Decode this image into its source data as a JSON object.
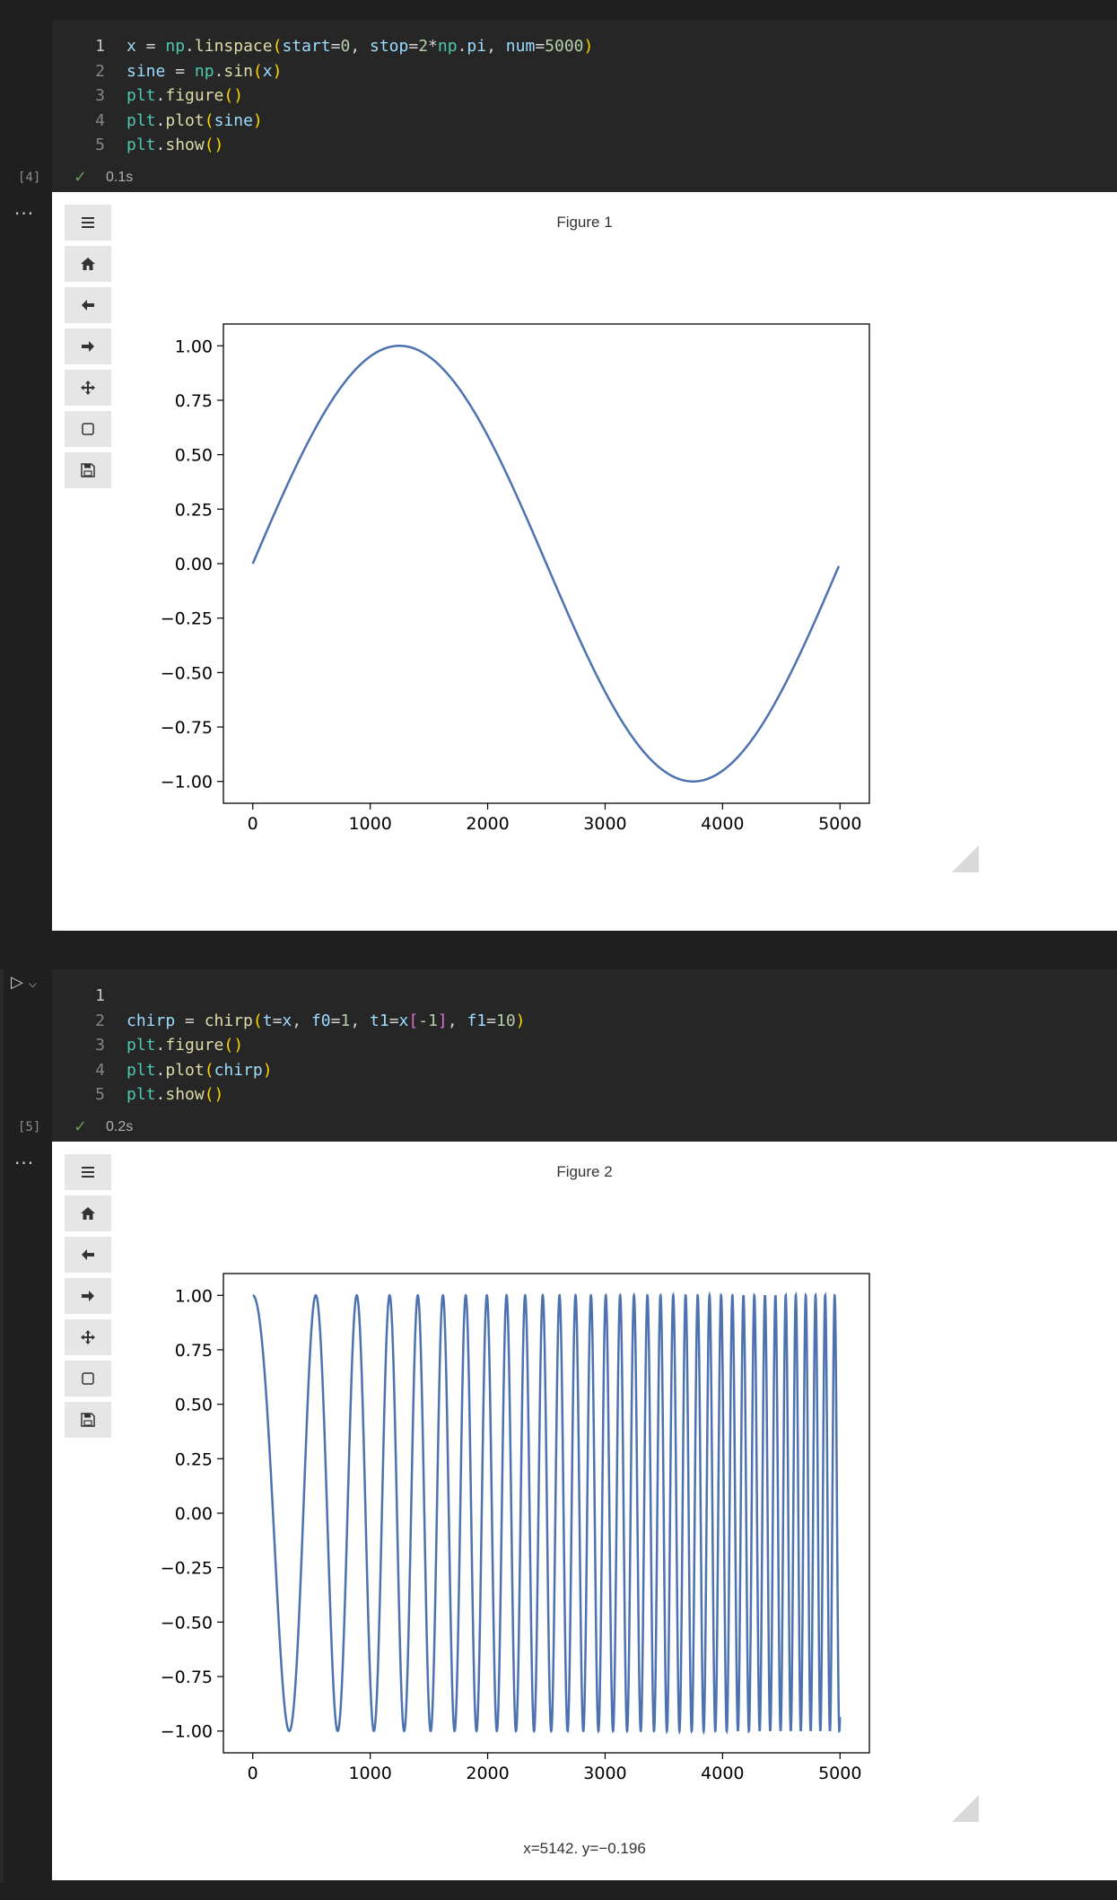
{
  "cells": [
    {
      "exec_label": "[4]",
      "status_time": "0.1s",
      "lines": [
        {
          "num": "1",
          "tokens": [
            [
              "x",
              "t-var"
            ],
            [
              " = ",
              "t-op"
            ],
            [
              "np",
              "t-mod"
            ],
            [
              ".",
              "t-op"
            ],
            [
              "linspace",
              "t-fn"
            ],
            [
              "(",
              "t-par"
            ],
            [
              "start",
              "t-var"
            ],
            [
              "=",
              "t-op"
            ],
            [
              "0",
              "t-num"
            ],
            [
              ", ",
              "t-op"
            ],
            [
              "stop",
              "t-var"
            ],
            [
              "=",
              "t-op"
            ],
            [
              "2",
              "t-num"
            ],
            [
              "*",
              "t-op"
            ],
            [
              "np",
              "t-mod"
            ],
            [
              ".",
              "t-op"
            ],
            [
              "pi",
              "t-var"
            ],
            [
              ", ",
              "t-op"
            ],
            [
              "num",
              "t-var"
            ],
            [
              "=",
              "t-op"
            ],
            [
              "5000",
              "t-num"
            ],
            [
              ")",
              "t-par"
            ]
          ]
        },
        {
          "num": "2",
          "tokens": [
            [
              "sine",
              "t-var"
            ],
            [
              " = ",
              "t-op"
            ],
            [
              "np",
              "t-mod"
            ],
            [
              ".",
              "t-op"
            ],
            [
              "sin",
              "t-fn"
            ],
            [
              "(",
              "t-par"
            ],
            [
              "x",
              "t-var"
            ],
            [
              ")",
              "t-par"
            ]
          ]
        },
        {
          "num": "3",
          "tokens": [
            [
              "plt",
              "t-mod"
            ],
            [
              ".",
              "t-op"
            ],
            [
              "figure",
              "t-fn"
            ],
            [
              "()",
              "t-par"
            ]
          ]
        },
        {
          "num": "4",
          "tokens": [
            [
              "plt",
              "t-mod"
            ],
            [
              ".",
              "t-op"
            ],
            [
              "plot",
              "t-fn"
            ],
            [
              "(",
              "t-par"
            ],
            [
              "sine",
              "t-var"
            ],
            [
              ")",
              "t-par"
            ]
          ]
        },
        {
          "num": "5",
          "tokens": [
            [
              "plt",
              "t-mod"
            ],
            [
              ".",
              "t-op"
            ],
            [
              "show",
              "t-fn"
            ],
            [
              "()",
              "t-par"
            ]
          ]
        }
      ],
      "figure_title": "Figure 1",
      "readout": ""
    },
    {
      "exec_label": "[5]",
      "status_time": "0.2s",
      "lines": [
        {
          "num": "1",
          "tokens": []
        },
        {
          "num": "2",
          "tokens": [
            [
              "chirp",
              "t-var"
            ],
            [
              " = ",
              "t-op"
            ],
            [
              "chirp",
              "t-fn"
            ],
            [
              "(",
              "t-par"
            ],
            [
              "t",
              "t-var"
            ],
            [
              "=",
              "t-op"
            ],
            [
              "x",
              "t-var"
            ],
            [
              ", ",
              "t-op"
            ],
            [
              "f0",
              "t-var"
            ],
            [
              "=",
              "t-op"
            ],
            [
              "1",
              "t-num"
            ],
            [
              ", ",
              "t-op"
            ],
            [
              "t1",
              "t-var"
            ],
            [
              "=",
              "t-op"
            ],
            [
              "x",
              "t-var"
            ],
            [
              "[",
              "t-par2"
            ],
            [
              "-1",
              "t-num"
            ],
            [
              "]",
              "t-par2"
            ],
            [
              ", ",
              "t-op"
            ],
            [
              "f1",
              "t-var"
            ],
            [
              "=",
              "t-op"
            ],
            [
              "10",
              "t-num"
            ],
            [
              ")",
              "t-par"
            ]
          ]
        },
        {
          "num": "3",
          "tokens": [
            [
              "plt",
              "t-mod"
            ],
            [
              ".",
              "t-op"
            ],
            [
              "figure",
              "t-fn"
            ],
            [
              "()",
              "t-par"
            ]
          ]
        },
        {
          "num": "4",
          "tokens": [
            [
              "plt",
              "t-mod"
            ],
            [
              ".",
              "t-op"
            ],
            [
              "plot",
              "t-fn"
            ],
            [
              "(",
              "t-par"
            ],
            [
              "chirp",
              "t-var"
            ],
            [
              ")",
              "t-par"
            ]
          ]
        },
        {
          "num": "5",
          "tokens": [
            [
              "plt",
              "t-mod"
            ],
            [
              ".",
              "t-op"
            ],
            [
              "show",
              "t-fn"
            ],
            [
              "()",
              "t-par"
            ]
          ]
        }
      ],
      "figure_title": "Figure 2",
      "readout": "x=5142. y=−0.196"
    }
  ],
  "toolbar_icons": [
    "menu-icon",
    "home-icon",
    "back-arrow-icon",
    "forward-arrow-icon",
    "pan-icon",
    "zoom-rect-icon",
    "save-icon"
  ],
  "chart_data": [
    {
      "type": "line",
      "title": "",
      "xlabel": "",
      "ylabel": "",
      "xlim": [
        -250,
        5250
      ],
      "ylim": [
        -1.1,
        1.1
      ],
      "xticks": [
        0,
        1000,
        2000,
        3000,
        4000,
        5000
      ],
      "xtick_labels": [
        "0",
        "1000",
        "2000",
        "3000",
        "4000",
        "5000"
      ],
      "yticks": [
        1.0,
        0.75,
        0.5,
        0.25,
        0.0,
        -0.25,
        -0.5,
        -0.75,
        -1.0
      ],
      "ytick_labels": [
        "1.00",
        "0.75",
        "0.50",
        "0.25",
        "0.00",
        "−0.25",
        "−0.50",
        "−0.75",
        "−1.00"
      ],
      "series": [
        {
          "function": "sine",
          "n_points": 5000,
          "x_start": 0,
          "x_end": 4999,
          "color": "#4c72b0"
        }
      ],
      "grid": false
    },
    {
      "type": "line",
      "title": "",
      "xlabel": "",
      "ylabel": "",
      "xlim": [
        -250,
        5250
      ],
      "ylim": [
        -1.1,
        1.1
      ],
      "xticks": [
        0,
        1000,
        2000,
        3000,
        4000,
        5000
      ],
      "xtick_labels": [
        "0",
        "1000",
        "2000",
        "3000",
        "4000",
        "5000"
      ],
      "yticks": [
        1.0,
        0.75,
        0.5,
        0.25,
        0.0,
        -0.25,
        -0.5,
        -0.75,
        -1.0
      ],
      "ytick_labels": [
        "1.00",
        "0.75",
        "0.50",
        "0.25",
        "0.00",
        "−0.25",
        "−0.50",
        "−0.75",
        "−1.00"
      ],
      "series": [
        {
          "function": "linear chirp",
          "f0": 1,
          "f1": 10,
          "n_points": 5000,
          "x_start": 0,
          "x_end": 4999,
          "color": "#4c72b0"
        }
      ],
      "grid": false
    }
  ]
}
